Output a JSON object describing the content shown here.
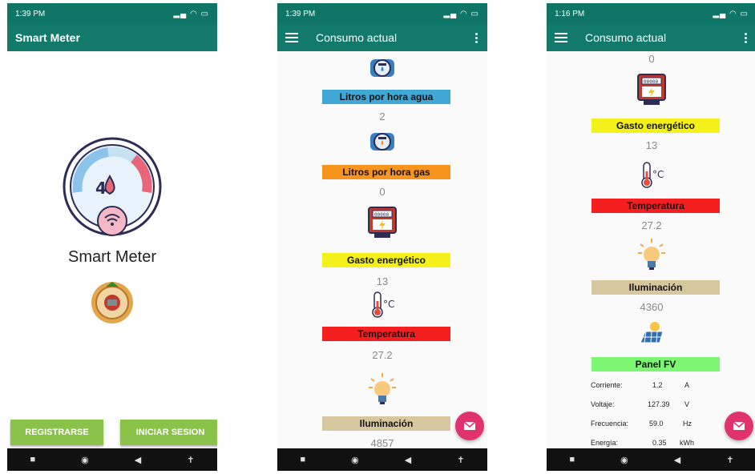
{
  "screen1": {
    "status_time": "1:39 PM",
    "app_title": "Smart Meter",
    "logo_text": "Smart Meter",
    "buttons": {
      "register": "REGISTRARSE",
      "login": "INICIAR SESION"
    }
  },
  "screen2": {
    "status_time": "1:39 PM",
    "title": "Consumo actual",
    "items": [
      {
        "label": "Litros por hora agua",
        "value": "2",
        "color": "#3fa8d4"
      },
      {
        "label": "Litros por hora gas",
        "value": "0",
        "color": "#f7941d"
      },
      {
        "label": "Gasto energético",
        "value": "13",
        "color": "#f4f01a"
      },
      {
        "label": "Temperatura",
        "value": "27.2",
        "color": "#f51e1e"
      },
      {
        "label": "Iluminación",
        "value": "4857",
        "color": "#d7c79e"
      }
    ]
  },
  "screen3": {
    "status_time": "1:16 PM",
    "title": "Consumo actual",
    "top_value": "0",
    "items": [
      {
        "label": "Gasto energético",
        "value": "13",
        "color": "#f4f01a"
      },
      {
        "label": "Temperatura",
        "value": "27.2",
        "color": "#f51e1e"
      },
      {
        "label": "Iluminación",
        "value": "4360",
        "color": "#d7c79e"
      }
    ],
    "panel": {
      "label": "Panel FV",
      "color": "#7cf774",
      "rows": [
        {
          "name": "Corriente:",
          "value": "1.2",
          "unit": "A"
        },
        {
          "name": "Voltaje:",
          "value": "127.39",
          "unit": "V"
        },
        {
          "name": "Frecuencia:",
          "value": "59.0",
          "unit": "Hz"
        },
        {
          "name": "Energía:",
          "value": "0.35",
          "unit": "kWh"
        }
      ]
    }
  },
  "nav": {
    "square": "■",
    "circle": "◉",
    "back": "◀",
    "access": "✝"
  }
}
